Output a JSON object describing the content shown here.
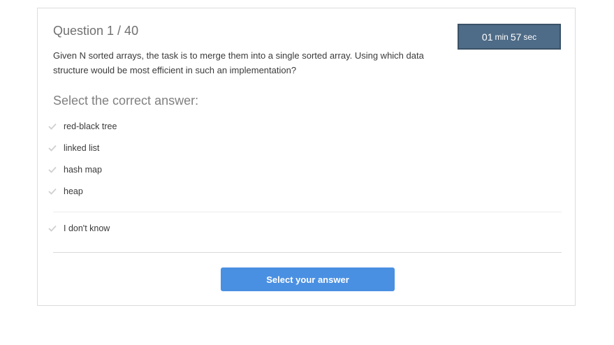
{
  "question": {
    "title": "Question 1 / 40",
    "text": "Given N sorted arrays, the task is to merge them into a single sorted array. Using which data structure would be most efficient in such an implementation?"
  },
  "timer": {
    "minutes": "01",
    "minutes_unit": "min",
    "seconds": "57",
    "seconds_unit": "sec"
  },
  "answers": {
    "heading": "Select the correct answer:",
    "options": [
      {
        "label": "red-black tree"
      },
      {
        "label": "linked list"
      },
      {
        "label": "hash map"
      },
      {
        "label": "heap"
      }
    ],
    "dont_know": "I don't know"
  },
  "submit": {
    "label": "Select your answer"
  },
  "colors": {
    "accent": "#4a90e2",
    "timer_bg": "#4e6b87",
    "check": "#cfcfcf"
  }
}
